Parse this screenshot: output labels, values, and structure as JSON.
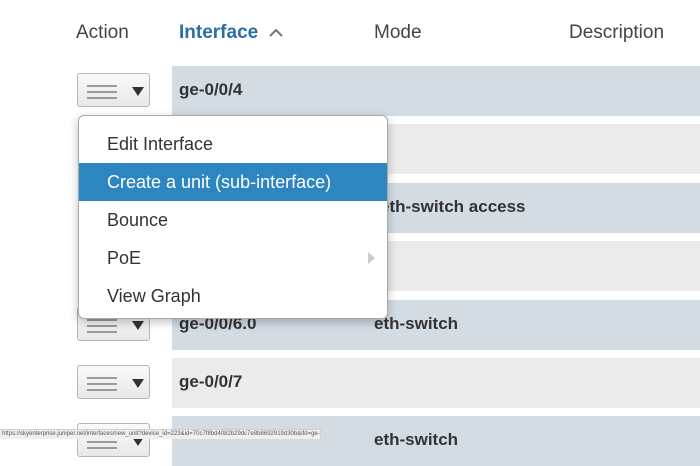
{
  "columns": {
    "action": "Action",
    "interface": "Interface",
    "mode": "Mode",
    "description": "Description"
  },
  "rows": [
    {
      "interface": "ge-0/0/4",
      "mode": ""
    },
    {
      "interface": "",
      "mode": ""
    },
    {
      "interface": "",
      "mode": "eth-switch access"
    },
    {
      "interface": "",
      "mode": ""
    },
    {
      "interface": "ge-0/0/6.0",
      "mode": "eth-switch"
    },
    {
      "interface": "ge-0/0/7",
      "mode": ""
    },
    {
      "interface": "",
      "mode": "eth-switch"
    }
  ],
  "context_menu": {
    "items": [
      {
        "label": "Edit Interface"
      },
      {
        "label": "Create a unit (sub-interface)",
        "highlighted": true
      },
      {
        "label": "Bounce"
      },
      {
        "label": "PoE",
        "has_submenu": true
      },
      {
        "label": "View Graph"
      }
    ]
  },
  "status_url": "https://skyenterprise.juniper.net/interfaces/new_unit?device_id=223&id=70c7f8bd4082b29dc7e8b8692919d30b&ifd=ge-0%2F0%2F4",
  "colors": {
    "sorted_header": "#2a6fa8",
    "menu_highlight": "#2e86c1",
    "row_blue": "#d3dbe3",
    "row_grey": "#ebebeb"
  },
  "icons": {
    "sort": "chevron-up-icon",
    "action_button": "hamburger-icon",
    "action_caret": "caret-down-icon",
    "submenu": "chevron-right-icon"
  }
}
